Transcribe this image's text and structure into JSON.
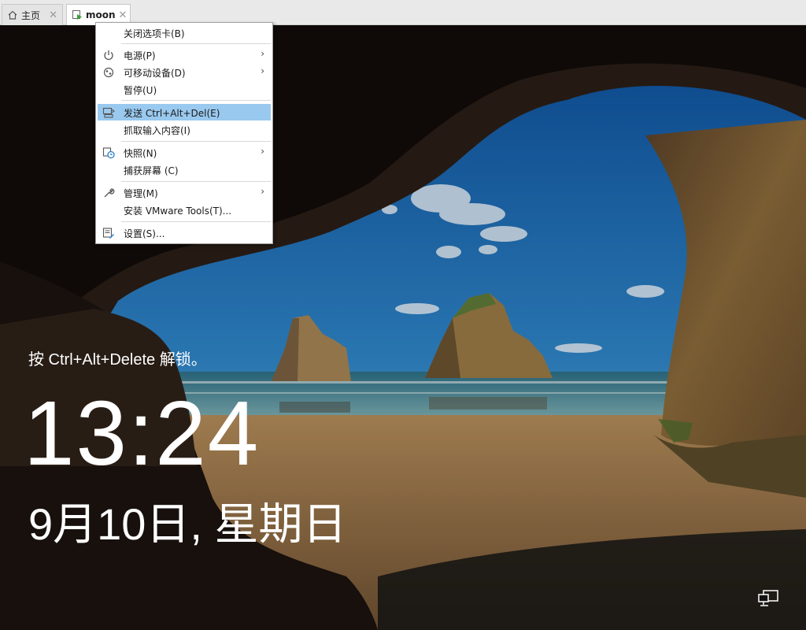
{
  "tabs": [
    {
      "label": "主页",
      "icon": "home-icon"
    },
    {
      "label": "moon",
      "icon": "vm-icon"
    }
  ],
  "context_menu": {
    "items": [
      {
        "label": "关闭选项卡(B)"
      },
      {
        "label": "电源(P)",
        "submenu": true,
        "icon": "power-icon"
      },
      {
        "label": "可移动设备(D)",
        "submenu": true,
        "icon": "removable-device-icon"
      },
      {
        "label": "暂停(U)"
      },
      {
        "label": "发送 Ctrl+Alt+Del(E)",
        "icon": "send-keys-icon",
        "highlighted": true
      },
      {
        "label": "抓取输入内容(I)"
      },
      {
        "label": "快照(N)",
        "submenu": true,
        "icon": "snapshot-icon"
      },
      {
        "label": "捕获屏幕 (C)"
      },
      {
        "label": "管理(M)",
        "submenu": true,
        "icon": "wrench-icon"
      },
      {
        "label": "安装 VMware Tools(T)..."
      },
      {
        "label": "设置(S)...",
        "icon": "settings-icon"
      }
    ],
    "submenu_arrow": "›"
  },
  "lock_screen": {
    "hint": "按 Ctrl+Alt+Delete 解锁。",
    "time": "13:24",
    "date": "9月10日, 星期日"
  },
  "close_glyph": "✕",
  "colors": {
    "menu_highlight": "#99c9ef",
    "tabbar_bg": "#e9e9e9",
    "lock_text": "#ffffff"
  }
}
